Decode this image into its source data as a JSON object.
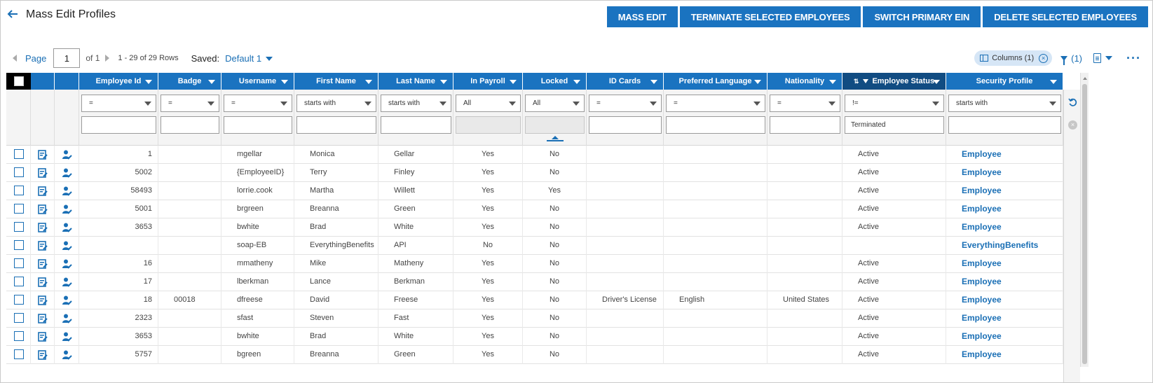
{
  "header": {
    "title": "Mass Edit Profiles",
    "buttons": [
      "MASS EDIT",
      "TERMINATE SELECTED EMPLOYEES",
      "SWITCH PRIMARY EIN",
      "DELETE SELECTED EMPLOYEES"
    ]
  },
  "toolbar": {
    "page_label": "Page",
    "page_value": "1",
    "of_text": "of 1",
    "rows_text": "1 - 29 of 29 Rows",
    "saved_label": "Saved:",
    "saved_value": "Default 1",
    "columns_chip": "Columns (1)",
    "filter_count": "(1)"
  },
  "columns": [
    {
      "key": "employee_id",
      "label": "Employee Id",
      "op": "=",
      "value": ""
    },
    {
      "key": "badge",
      "label": "Badge",
      "op": "=",
      "value": ""
    },
    {
      "key": "username",
      "label": "Username",
      "op": "=",
      "value": ""
    },
    {
      "key": "first_name",
      "label": "First Name",
      "op": "starts with",
      "value": ""
    },
    {
      "key": "last_name",
      "label": "Last Name",
      "op": "starts with",
      "value": ""
    },
    {
      "key": "in_payroll",
      "label": "In Payroll",
      "op": "All",
      "value": ""
    },
    {
      "key": "locked",
      "label": "Locked",
      "op": "All",
      "value": ""
    },
    {
      "key": "id_cards",
      "label": "ID Cards",
      "op": "=",
      "value": ""
    },
    {
      "key": "preferred_language",
      "label": "Preferred Language",
      "op": "=",
      "value": ""
    },
    {
      "key": "nationality",
      "label": "Nationality",
      "op": "=",
      "value": ""
    },
    {
      "key": "employee_status",
      "label": "Employee Status",
      "op": "!=",
      "value": "Terminated"
    },
    {
      "key": "security_profile",
      "label": "Security Profile",
      "op": "starts with",
      "value": ""
    }
  ],
  "rows": [
    {
      "employee_id": "1",
      "badge": "",
      "username": "mgellar",
      "first_name": "Monica",
      "last_name": "Gellar",
      "in_payroll": "Yes",
      "locked": "No",
      "id_cards": "",
      "preferred_language": "",
      "nationality": "",
      "employee_status": "Active",
      "security_profile": "Employee"
    },
    {
      "employee_id": "5002",
      "badge": "",
      "username": "{EmployeeID}",
      "first_name": "Terry",
      "last_name": "Finley",
      "in_payroll": "Yes",
      "locked": "No",
      "id_cards": "",
      "preferred_language": "",
      "nationality": "",
      "employee_status": "Active",
      "security_profile": "Employee"
    },
    {
      "employee_id": "58493",
      "badge": "",
      "username": "lorrie.cook",
      "first_name": "Martha",
      "last_name": "Willett",
      "in_payroll": "Yes",
      "locked": "Yes",
      "id_cards": "",
      "preferred_language": "",
      "nationality": "",
      "employee_status": "Active",
      "security_profile": "Employee"
    },
    {
      "employee_id": "5001",
      "badge": "",
      "username": "brgreen",
      "first_name": "Breanna",
      "last_name": "Green",
      "in_payroll": "Yes",
      "locked": "No",
      "id_cards": "",
      "preferred_language": "",
      "nationality": "",
      "employee_status": "Active",
      "security_profile": "Employee"
    },
    {
      "employee_id": "3653",
      "badge": "",
      "username": "bwhite",
      "first_name": "Brad",
      "last_name": "White",
      "in_payroll": "Yes",
      "locked": "No",
      "id_cards": "",
      "preferred_language": "",
      "nationality": "",
      "employee_status": "Active",
      "security_profile": "Employee"
    },
    {
      "employee_id": "",
      "badge": "",
      "username": "soap-EB",
      "first_name": "EverythingBenefits",
      "last_name": "API",
      "in_payroll": "No",
      "locked": "No",
      "id_cards": "",
      "preferred_language": "",
      "nationality": "",
      "employee_status": "",
      "security_profile": "EverythingBenefits"
    },
    {
      "employee_id": "16",
      "badge": "",
      "username": "mmatheny",
      "first_name": "Mike",
      "last_name": "Matheny",
      "in_payroll": "Yes",
      "locked": "No",
      "id_cards": "",
      "preferred_language": "",
      "nationality": "",
      "employee_status": "Active",
      "security_profile": "Employee"
    },
    {
      "employee_id": "17",
      "badge": "",
      "username": "lberkman",
      "first_name": "Lance",
      "last_name": "Berkman",
      "in_payroll": "Yes",
      "locked": "No",
      "id_cards": "",
      "preferred_language": "",
      "nationality": "",
      "employee_status": "Active",
      "security_profile": "Employee"
    },
    {
      "employee_id": "18",
      "badge": "00018",
      "username": "dfreese",
      "first_name": "David",
      "last_name": "Freese",
      "in_payroll": "Yes",
      "locked": "No",
      "id_cards": "Driver's License",
      "preferred_language": "English",
      "nationality": "United States",
      "employee_status": "Active",
      "security_profile": "Employee"
    },
    {
      "employee_id": "2323",
      "badge": "",
      "username": "sfast",
      "first_name": "Steven",
      "last_name": "Fast",
      "in_payroll": "Yes",
      "locked": "No",
      "id_cards": "",
      "preferred_language": "",
      "nationality": "",
      "employee_status": "Active",
      "security_profile": "Employee"
    },
    {
      "employee_id": "3653",
      "badge": "",
      "username": "bwhite",
      "first_name": "Brad",
      "last_name": "White",
      "in_payroll": "Yes",
      "locked": "No",
      "id_cards": "",
      "preferred_language": "",
      "nationality": "",
      "employee_status": "Active",
      "security_profile": "Employee"
    },
    {
      "employee_id": "5757",
      "badge": "",
      "username": "bgreen",
      "first_name": "Breanna",
      "last_name": "Green",
      "in_payroll": "Yes",
      "locked": "No",
      "id_cards": "",
      "preferred_language": "",
      "nationality": "",
      "employee_status": "Active",
      "security_profile": "Employee"
    }
  ],
  "colors": {
    "primary": "#1a73c0",
    "sorted_header": "#114c82",
    "link": "#1a6fb5"
  }
}
